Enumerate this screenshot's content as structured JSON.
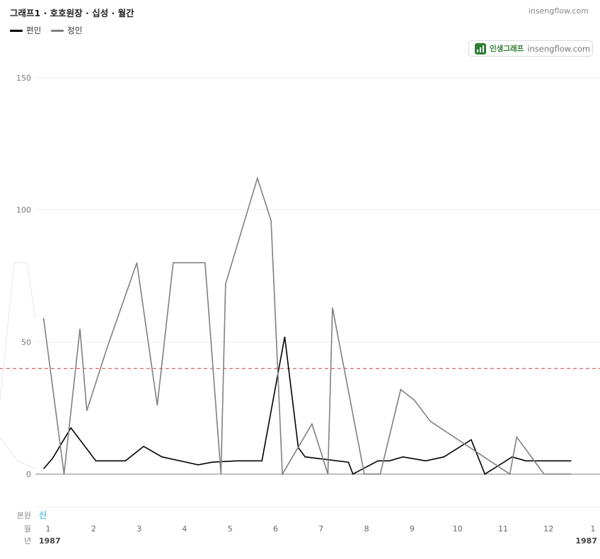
{
  "header": {
    "title": "그래프1 · 호호원장 · 십성 · 월간",
    "site": "insengflow.com"
  },
  "badge": {
    "name": "인생그래프",
    "site": "insengflow.com"
  },
  "colors": {
    "series1": "#000000",
    "series2": "#808080",
    "reference_line": "#d9534f",
    "grid": "#eeeeee",
    "accent_label": "#5bc0de"
  },
  "chart_data": {
    "type": "line",
    "title": "그래프1 · 호호원장 · 십성 · 월간",
    "ylim": [
      0,
      150
    ],
    "yticks": [
      0,
      50,
      100,
      150
    ],
    "grid": true,
    "legend_position": "top-left",
    "reference_line": 40,
    "x_months": [
      1,
      2,
      3,
      4,
      5,
      6,
      7,
      8,
      9,
      10,
      11,
      12,
      1
    ],
    "x_range": [
      0.9,
      13
    ],
    "series": [
      {
        "name": "편인",
        "x": [
          0.9,
          1.1,
          1.5,
          2.05,
          2.7,
          3.1,
          3.5,
          4.3,
          4.6,
          5.15,
          5.7,
          6.2,
          6.5,
          6.65,
          7.6,
          7.7,
          8.25,
          8.5,
          8.8,
          9.3,
          9.7,
          10.3,
          10.6,
          11.2,
          11.5,
          12.5
        ],
        "y": [
          2,
          6,
          17.5,
          5,
          5,
          10.5,
          6.5,
          3.5,
          4.5,
          5,
          5,
          52,
          10,
          6.5,
          4.5,
          0,
          5,
          5,
          6.5,
          5,
          6.5,
          13,
          0,
          6.5,
          5,
          5
        ]
      },
      {
        "name": "정인",
        "x": [
          0.9,
          1.35,
          1.7,
          1.85,
          2.3,
          2.95,
          3.4,
          3.75,
          4.45,
          4.8,
          4.9,
          5.6,
          5.9,
          6.15,
          6.8,
          7.15,
          7.25,
          7.95,
          8.3,
          8.75,
          9.05,
          9.4,
          11.15,
          11.3,
          11.9,
          12.5
        ],
        "y": [
          59,
          0,
          55,
          24,
          48,
          80,
          26,
          80,
          80,
          0,
          72,
          112,
          96,
          0,
          19,
          0,
          63,
          0,
          0,
          32,
          28,
          20,
          0,
          14,
          0,
          0
        ]
      }
    ],
    "bottom_axis": {
      "row1_label": "본원",
      "row1_value": "신",
      "row2_label": "월",
      "row3_label": "년",
      "year_start": "1987",
      "year_end": "1987"
    }
  }
}
